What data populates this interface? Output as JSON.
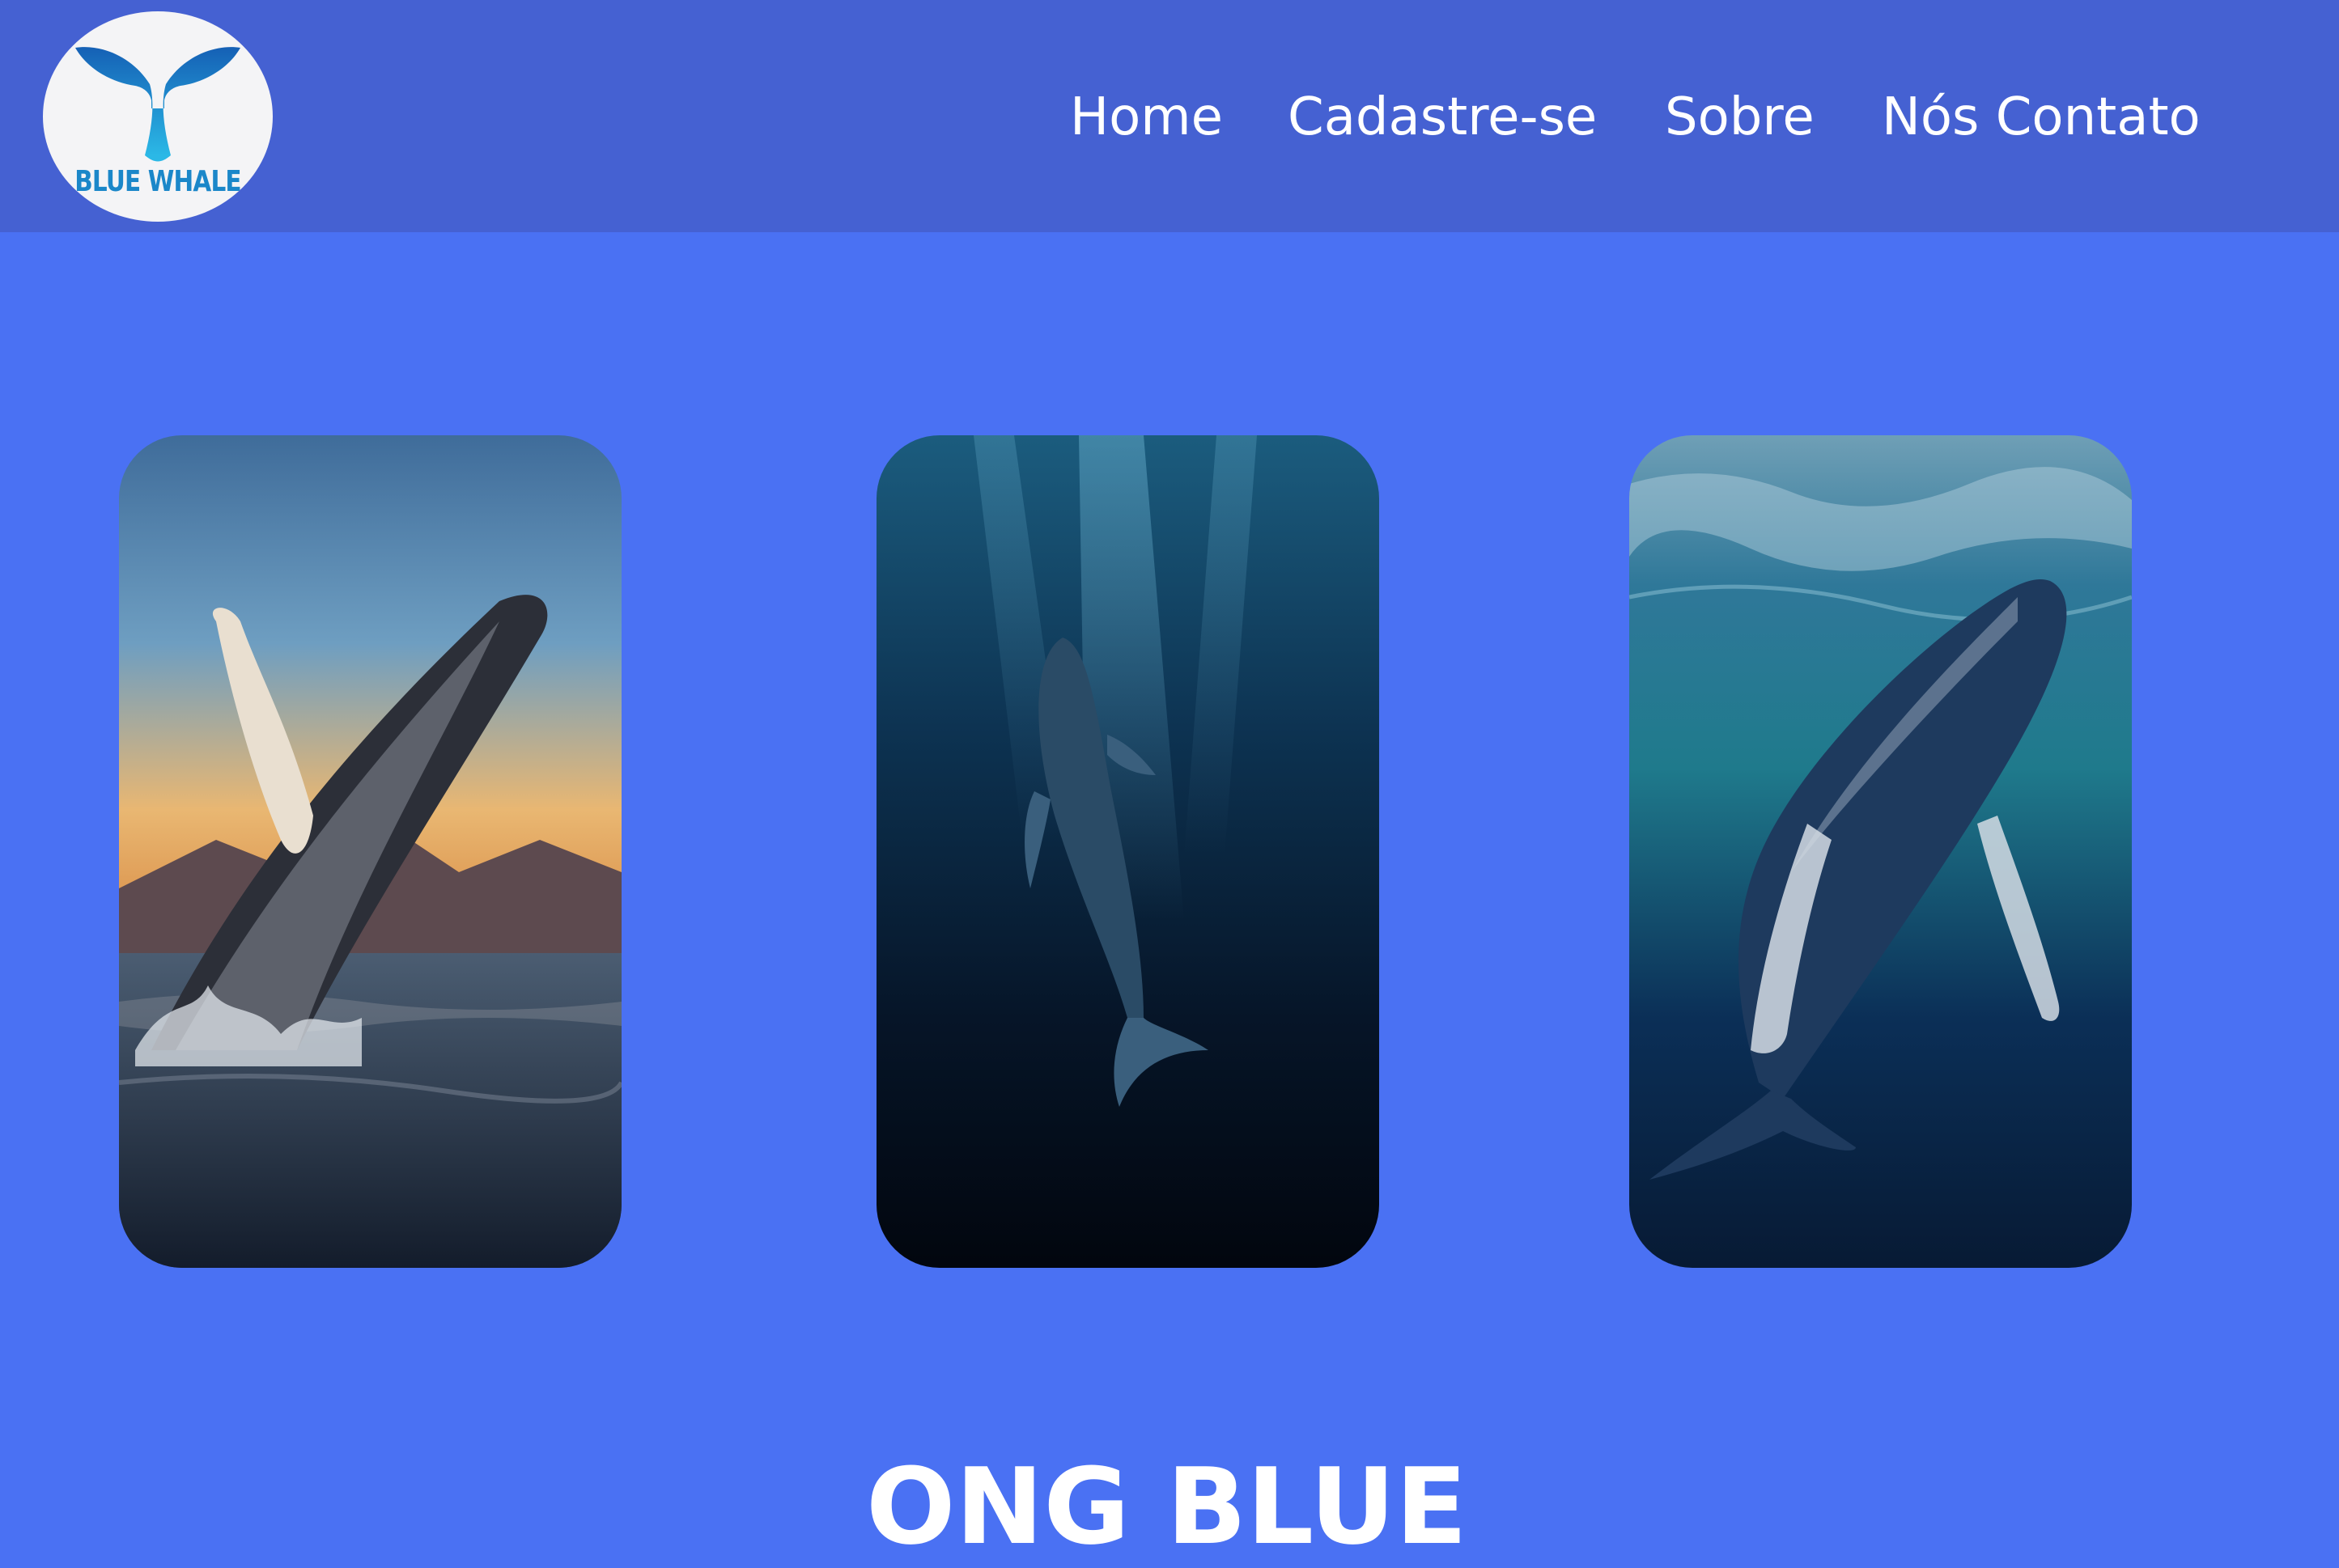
{
  "header": {
    "logo": {
      "text": "BLUE WHALE",
      "icon": "whale-tail-icon"
    },
    "nav": [
      {
        "label": "Home"
      },
      {
        "label": "Cadastre-se"
      },
      {
        "label": "Sobre"
      },
      {
        "label": "Nós Contato"
      }
    ]
  },
  "gallery": {
    "cards": [
      {
        "image": "humpback-whale-breaching-sunset"
      },
      {
        "image": "blue-whale-deep-underwater"
      },
      {
        "image": "humpback-whale-underwater-surface-light"
      }
    ]
  },
  "main": {
    "headline": "ONG BLUE"
  },
  "colors": {
    "header_bg": "#4561d2",
    "page_bg": "#4a71f3",
    "text": "#ffffff",
    "logo_brand": "#1b87c9"
  }
}
